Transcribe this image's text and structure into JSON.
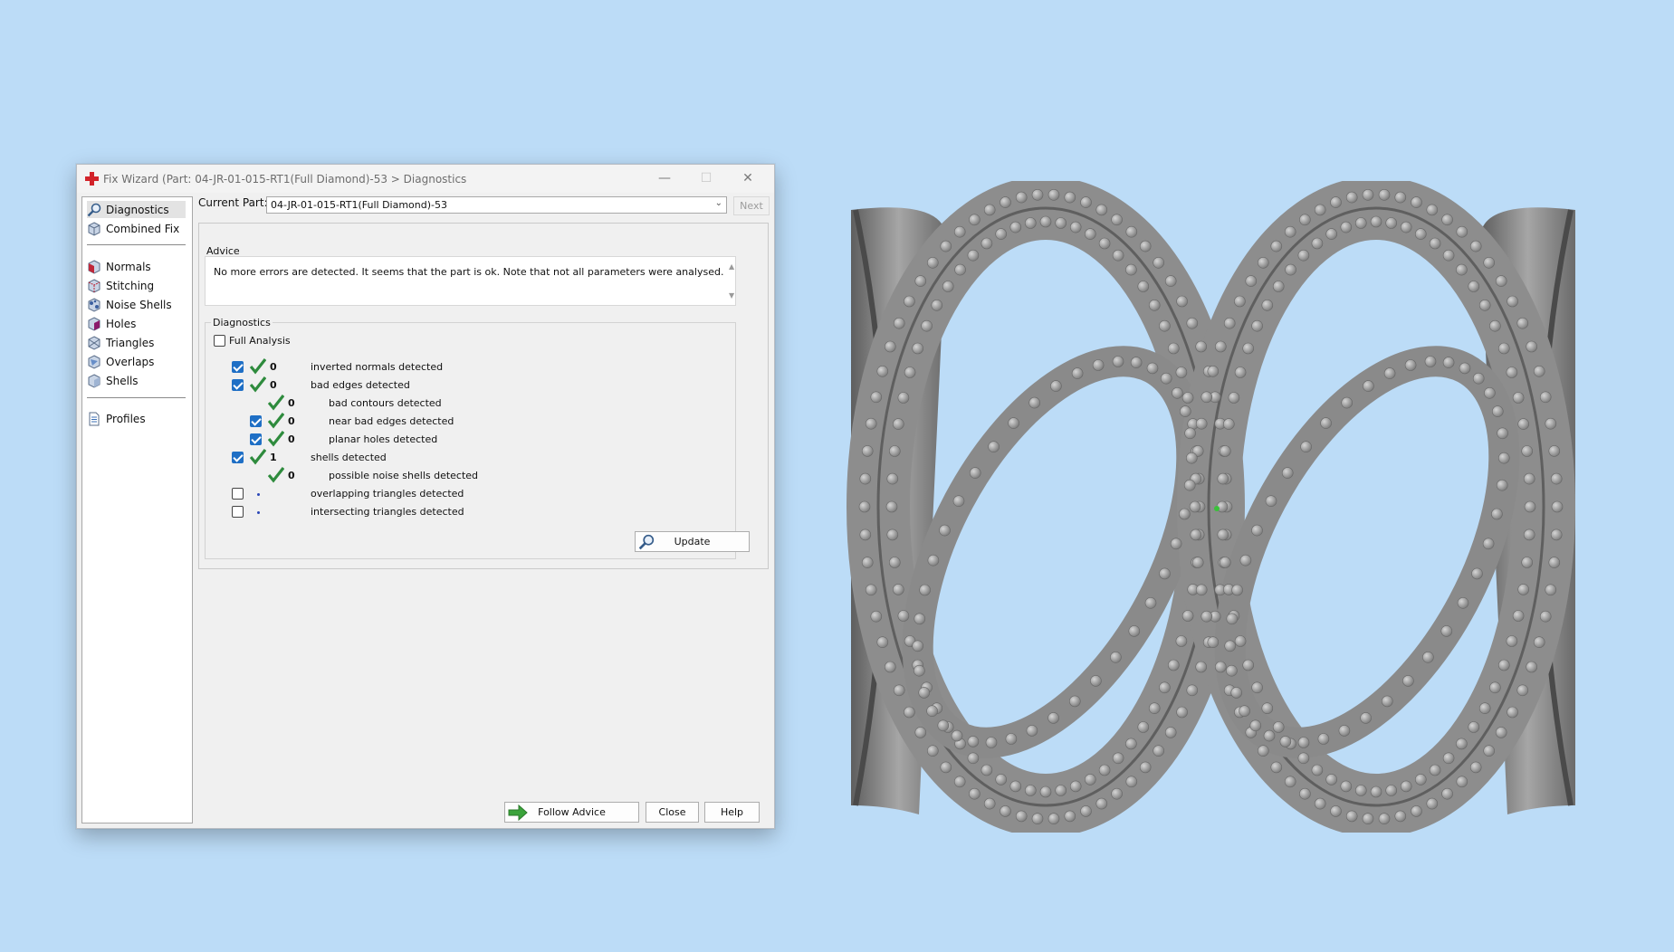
{
  "window": {
    "title": "Fix Wizard (Part: 04-JR-01-015-RT1(Full Diamond)-53 > Diagnostics",
    "controls": {
      "minimize": "—",
      "maximize": "☐",
      "close": "✕"
    }
  },
  "sidebar": {
    "items": [
      {
        "label": "Diagnostics",
        "icon": "magnifier-icon",
        "selected": true
      },
      {
        "label": "Combined Fix",
        "icon": "cube-icon"
      },
      {
        "label": "Normals",
        "icon": "normals-cube-icon"
      },
      {
        "label": "Stitching",
        "icon": "stitching-cube-icon"
      },
      {
        "label": "Noise Shells",
        "icon": "noise-shells-icon"
      },
      {
        "label": "Holes",
        "icon": "holes-cube-icon"
      },
      {
        "label": "Triangles",
        "icon": "triangles-cube-icon"
      },
      {
        "label": "Overlaps",
        "icon": "overlaps-cube-icon"
      },
      {
        "label": "Shells",
        "icon": "shells-cube-icon"
      },
      {
        "label": "Profiles",
        "icon": "document-icon"
      }
    ]
  },
  "current_part": {
    "label": "Current Part:",
    "value": "04-JR-01-015-RT1(Full Diamond)-53",
    "next_label": "Next"
  },
  "advice": {
    "legend": "Advice",
    "text": "No more errors are detected. It seems that the part is ok. Note that not all parameters were analysed."
  },
  "diagnostics": {
    "legend": "Diagnostics",
    "full_analysis": {
      "label": "Full Analysis",
      "checked": false
    },
    "rows": [
      {
        "label": "inverted normals detected",
        "count": "0",
        "checkbox": true,
        "checked": true,
        "status": "ok",
        "indent": 0
      },
      {
        "label": "bad edges detected",
        "count": "0",
        "checkbox": true,
        "checked": true,
        "status": "ok",
        "indent": 0
      },
      {
        "label": "bad contours detected",
        "count": "0",
        "checkbox": false,
        "checked": false,
        "status": "ok",
        "indent": 1
      },
      {
        "label": "near bad edges detected",
        "count": "0",
        "checkbox": true,
        "checked": true,
        "status": "ok",
        "indent": 1
      },
      {
        "label": "planar holes detected",
        "count": "0",
        "checkbox": true,
        "checked": true,
        "status": "ok",
        "indent": 1
      },
      {
        "label": "shells detected",
        "count": "1",
        "checkbox": true,
        "checked": true,
        "status": "ok",
        "indent": 0
      },
      {
        "label": "possible noise shells detected",
        "count": "0",
        "checkbox": false,
        "checked": false,
        "status": "ok",
        "indent": 1
      },
      {
        "label": "overlapping triangles detected",
        "count": "",
        "checkbox": true,
        "checked": false,
        "status": "pending",
        "indent": 0
      },
      {
        "label": "intersecting triangles detected",
        "count": "",
        "checkbox": true,
        "checked": false,
        "status": "pending",
        "indent": 0
      }
    ],
    "update_label": "Update"
  },
  "footer": {
    "follow_advice": "Follow Advice",
    "close": "Close",
    "help": "Help"
  },
  "colors": {
    "desktop": "#bcdcf7",
    "check_blue": "#1f6fc5",
    "ok_green": "#2e8b3d",
    "model_gray": "#8d8d8d"
  }
}
